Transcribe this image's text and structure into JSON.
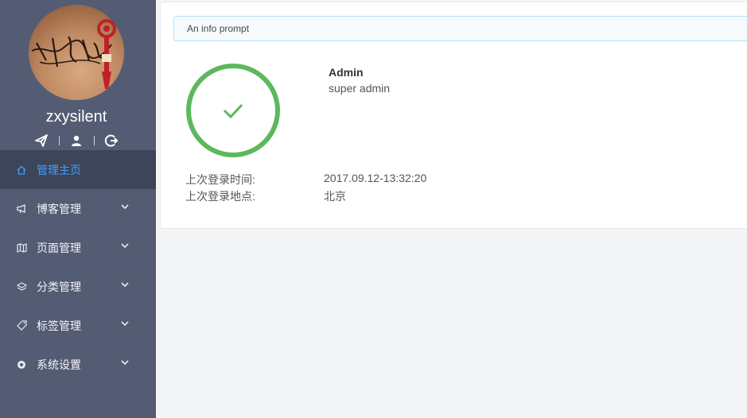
{
  "sidebar": {
    "username": "zxysilent",
    "avatar_signature": "黄祥银",
    "menu": [
      {
        "label": "管理主页",
        "icon": "home-icon",
        "active": true,
        "expandable": false
      },
      {
        "label": "博客管理",
        "icon": "megaphone-icon",
        "active": false,
        "expandable": true
      },
      {
        "label": "页面管理",
        "icon": "map-icon",
        "active": false,
        "expandable": true
      },
      {
        "label": "分类管理",
        "icon": "layers-icon",
        "active": false,
        "expandable": true
      },
      {
        "label": "标签管理",
        "icon": "tag-icon",
        "active": false,
        "expandable": true
      },
      {
        "label": "系统设置",
        "icon": "gear-icon",
        "active": false,
        "expandable": true
      }
    ],
    "colors": {
      "background": "#545c74",
      "active_background": "#3d4559",
      "active_text": "#409eff"
    }
  },
  "main": {
    "info_prompt": "An info prompt",
    "admin_name": "Admin",
    "admin_role": "super admin",
    "last_login_time_label": "上次登录时间:",
    "last_login_time": "2017.09.12-13:32:20",
    "last_login_place_label": "上次登录地点:",
    "last_login_place": "北京",
    "status_color": "#5cb85c"
  }
}
